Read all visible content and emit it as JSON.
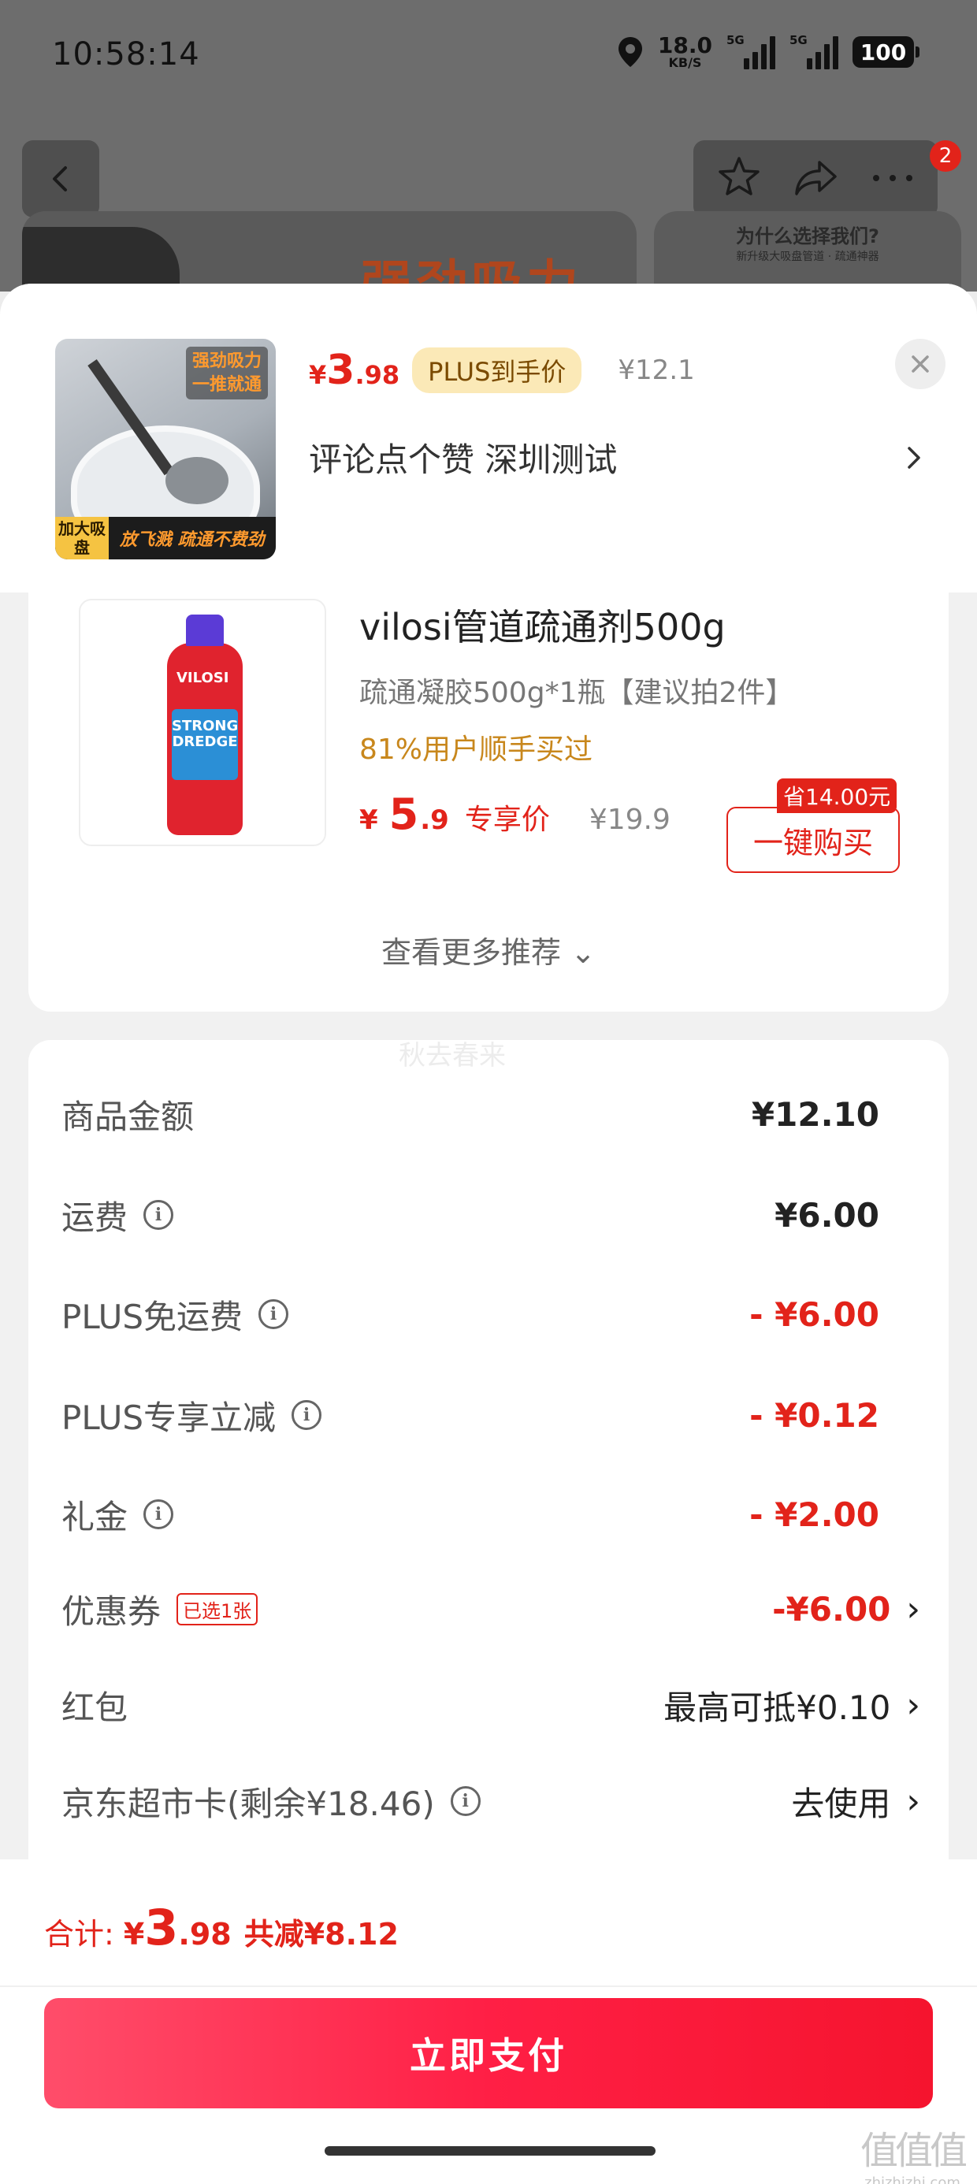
{
  "status_bar": {
    "time": "10:58:14",
    "net_speed_value": "18.0",
    "net_speed_unit": "KB/S",
    "signal1_label": "5G",
    "signal2_label": "5G",
    "battery": "100"
  },
  "nav": {
    "badge_count": "2"
  },
  "banner": {
    "left_text": "强劲吸力",
    "right_title": "为什么选择我们?",
    "right_sub": "新升级大吸盘管道 · 疏通神器"
  },
  "product": {
    "thumb_caption_line1": "强劲吸力",
    "thumb_caption_line2": "一推就通",
    "thumb_tag": "加大吸盘",
    "thumb_footer": "放飞溅 疏通不费劲",
    "price_currency": "¥",
    "price_int": "3",
    "price_dec": ".98",
    "plus_chip": "PLUS到手价",
    "original_price": "¥12.1",
    "spec": "评论点个赞  深圳测试"
  },
  "recommendation": {
    "bottle_brand": "VILOSI",
    "bottle_label": "STRONG DREDGE",
    "title": "vilosi管道疏通剂500g",
    "subtitle": "疏通凝胶500g*1瓶【建议拍2件】",
    "stat": "81%用户顺手买过",
    "price_currency": "¥",
    "price_int": "5",
    "price_dec": ".9",
    "price_label": "专享价",
    "original_price": "¥19.9",
    "save_tag": "省14.00元",
    "buy_label": "一键购买",
    "more_label": "查看更多推荐 ⌄"
  },
  "summary": {
    "watermark": "秋去春来",
    "rows": [
      {
        "label": "商品金额",
        "value": "¥12.10"
      },
      {
        "label": "运费",
        "value": "¥6.00"
      },
      {
        "label": "PLUS免运费",
        "value": "- ¥6.00"
      },
      {
        "label": "PLUS专享立减",
        "value": "- ¥0.12"
      },
      {
        "label": "礼金",
        "value": "- ¥2.00"
      },
      {
        "label": "优惠券",
        "chip": "已选1张",
        "value": "-¥6.00"
      },
      {
        "label": "红包",
        "value": "最高可抵¥0.10"
      },
      {
        "label": "京东超市卡(剩余¥18.46)",
        "value": "去使用"
      }
    ]
  },
  "footer": {
    "total_label": "合计:",
    "total_currency": "¥",
    "total_int": "3",
    "total_dec": ".98",
    "total_saved": "共减¥8.12",
    "pay_label": "立即支付"
  },
  "watermark_site": {
    "glyphs": "值值值",
    "url": "zhizhizhi.com"
  },
  "colors": {
    "accent_red": "#e2231a",
    "plus_gold": "#fbe9b7",
    "stat_orange": "#c8871c"
  }
}
